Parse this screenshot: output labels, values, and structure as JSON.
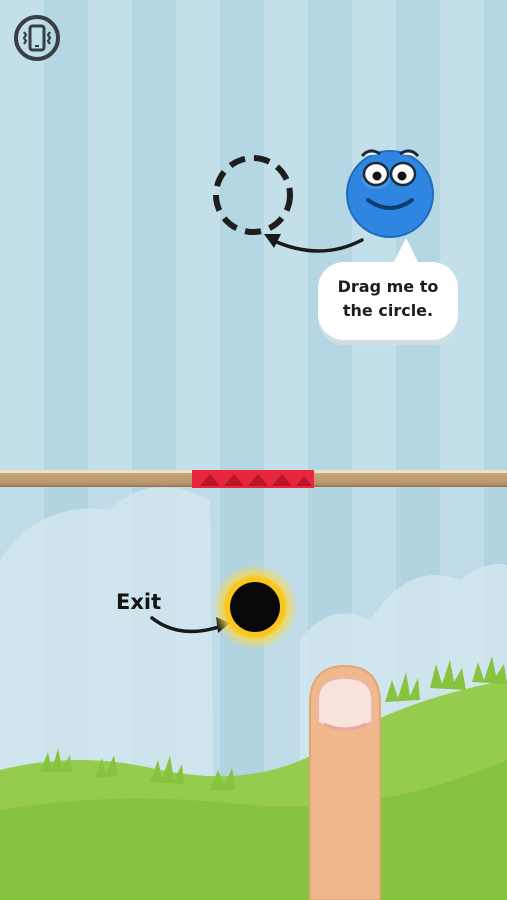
{
  "game": {
    "hint_text_line1": "Drag me to",
    "hint_text_line2": "the circle.",
    "exit_label": "Exit"
  },
  "colors": {
    "sky_stripe_light": "#c3e0ea",
    "sky_stripe_dark": "#b5d7e3",
    "ball_blue": "#2f86e0",
    "spikes_red": "#e8273d",
    "exit_ring_yellow": "#f9c61c",
    "grass_green": "#86c440",
    "finger_skin": "#f0b88c"
  },
  "icons": {
    "vibrate": "vibrate-phone-icon",
    "target": "dashed-circle-target",
    "exit": "exit-hole"
  }
}
